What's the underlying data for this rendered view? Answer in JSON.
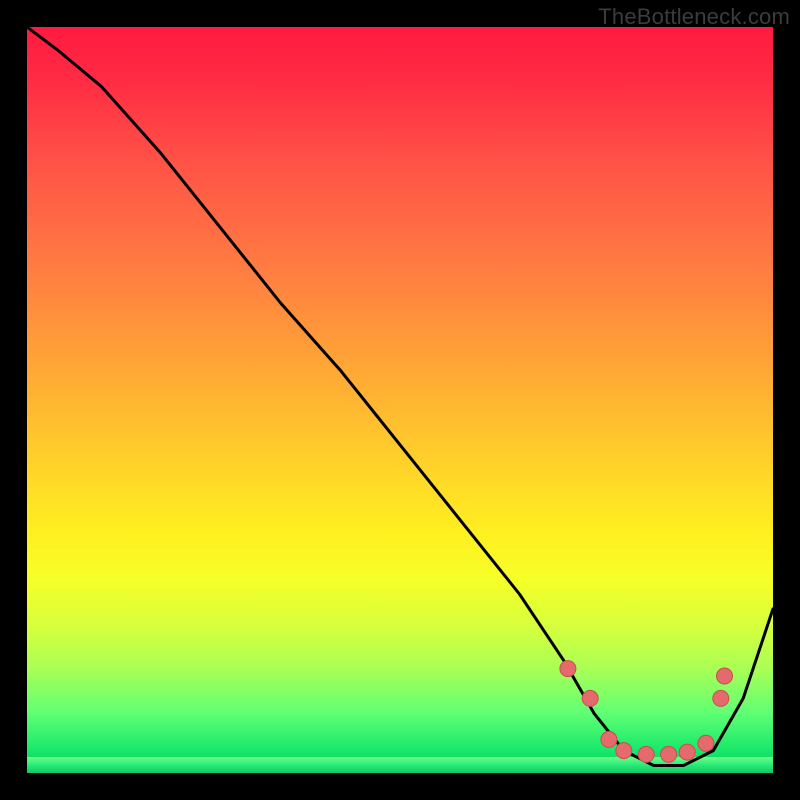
{
  "watermark": "TheBottleneck.com",
  "colors": {
    "marker_fill": "#e46a6c",
    "marker_stroke": "#c94d50",
    "line": "#000000"
  },
  "chart_data": {
    "type": "line",
    "title": "",
    "xlabel": "",
    "ylabel": "",
    "xlim": [
      0,
      100
    ],
    "ylim": [
      0,
      100
    ],
    "grid": false,
    "legend": false,
    "series": [
      {
        "name": "curve",
        "x": [
          0,
          4,
          10,
          18,
          26,
          34,
          42,
          50,
          58,
          66,
          72,
          76,
          80,
          84,
          88,
          92,
          96,
          100
        ],
        "y": [
          100,
          97,
          92,
          83,
          73,
          63,
          54,
          44,
          34,
          24,
          15,
          8,
          3,
          1,
          1,
          3,
          10,
          22
        ]
      }
    ],
    "markers": {
      "name": "dots",
      "x": [
        72.5,
        75.5,
        78,
        80,
        83,
        86,
        88.5,
        91,
        93,
        93.5
      ],
      "y": [
        14,
        10,
        4.5,
        3,
        2.5,
        2.5,
        2.8,
        4,
        10,
        13
      ]
    }
  }
}
